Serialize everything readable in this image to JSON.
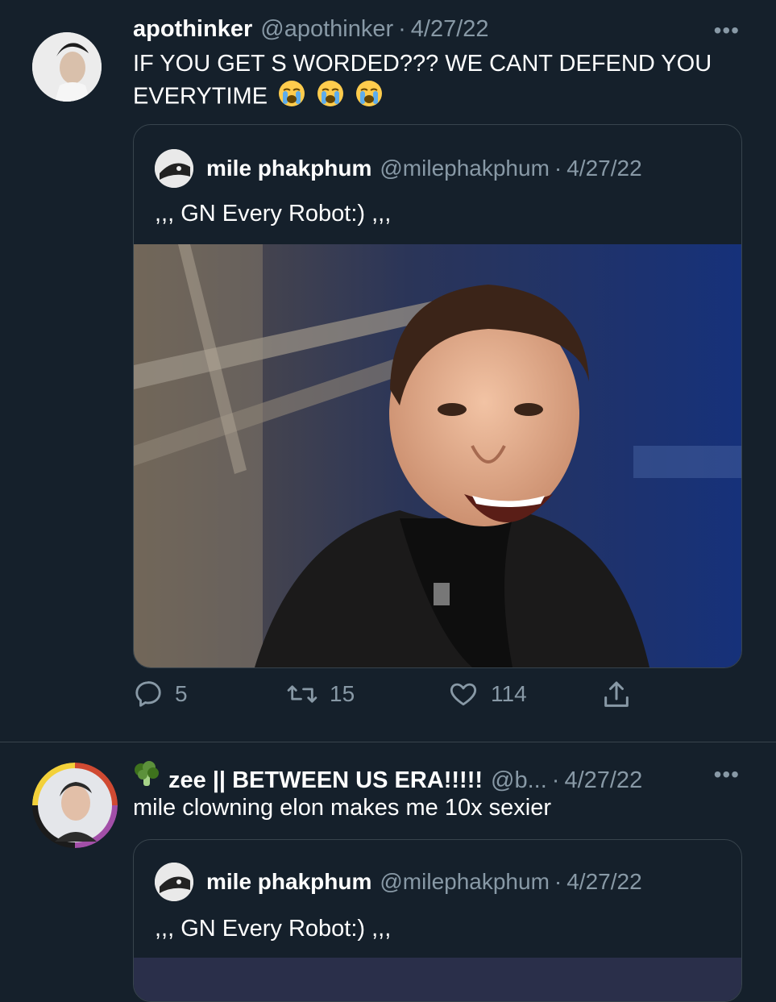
{
  "tweets": [
    {
      "name": "apothinker",
      "handle": "@apothinker",
      "separator": "·",
      "date": "4/27/22",
      "more": "•••",
      "text": "IF YOU GET S WORDED??? WE CANT DEFEND YOU EVERYTIME",
      "emoji": [
        "loudly-crying-face",
        "loudly-crying-face",
        "loudly-crying-face"
      ],
      "quote": {
        "name": "mile phakphum",
        "handle": "@milephakphum",
        "separator": "·",
        "date": "4/27/22",
        "text": ",,, GN Every Robot:) ,,,"
      },
      "actions": {
        "replies": "5",
        "retweets": "15",
        "likes": "114"
      }
    },
    {
      "badge_icon": "broccoli-icon",
      "name": "zee || BETWEEN US ERA!!!!!",
      "handle": "@b...",
      "separator": "·",
      "date": "4/27/22",
      "more": "•••",
      "text": "mile clowning elon makes me 10x sexier",
      "quote": {
        "name": "mile phakphum",
        "handle": "@milephakphum",
        "separator": "·",
        "date": "4/27/22",
        "text": ",,, GN Every Robot:) ,,,"
      }
    }
  ],
  "colors": {
    "background": "#15202b",
    "text": "#ffffff",
    "muted": "#8899a6",
    "border": "#38444d"
  }
}
